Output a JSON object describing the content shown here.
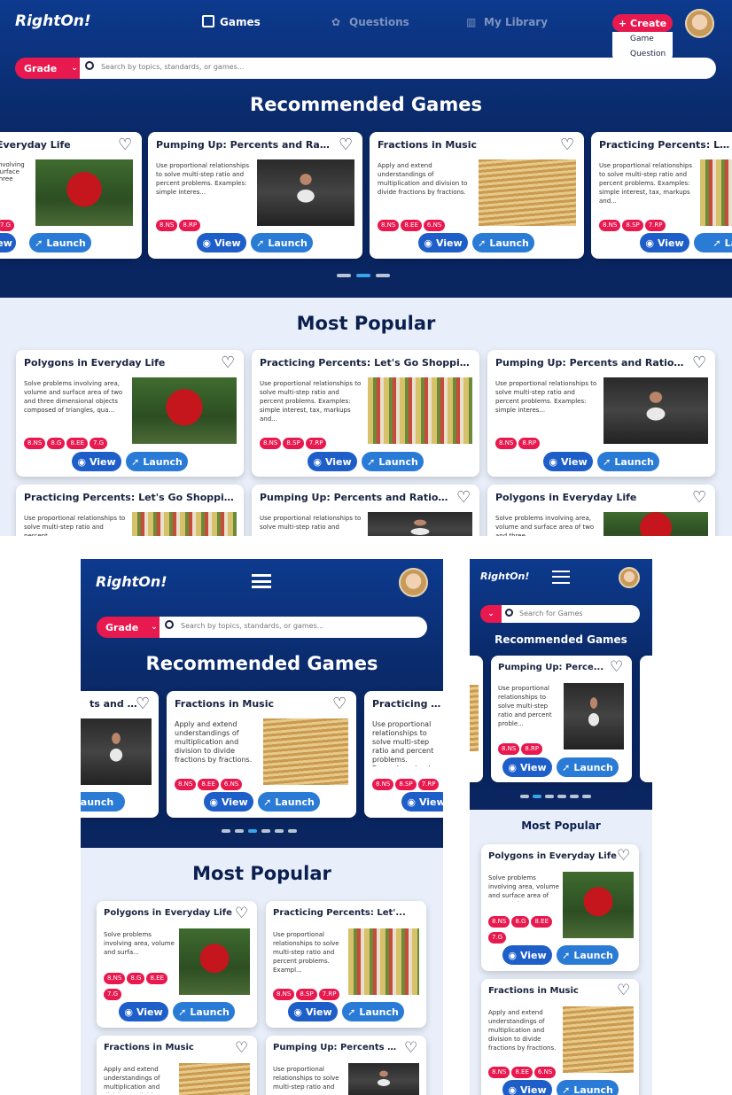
{
  "brand": "RightOn!",
  "nav": {
    "games": "Games",
    "questions": "Questions",
    "library": "My Library",
    "create": "Create",
    "create_menu": [
      "Game",
      "Question"
    ]
  },
  "search": {
    "grade": "Grade",
    "placeholder": "Search by topics, standards, or games...",
    "placeholder_mobile": "Search for Games"
  },
  "sections": {
    "recommended": "Recommended Games",
    "popular": "Most Popular"
  },
  "buttons": {
    "view": "View",
    "launch": "Launch"
  },
  "games": {
    "poly": {
      "title": "Polygons in Everyday Life",
      "desc": "Solve problems involving area, volume and surface area of two and three dimensional objects composed of triangles, qua...",
      "tags": [
        "8.NS",
        "8.G",
        "8.EE",
        "7.G"
      ]
    },
    "pump": {
      "title": "Pumping Up: Percents and Ratios at t...",
      "desc": "Use proportional relationships to solve multi-step ratio and percent problems. Examples: simple interes...",
      "tags": [
        "8.NS",
        "8.RP"
      ]
    },
    "frac": {
      "title": "Fractions in Music",
      "desc": "Apply and extend understandings of multiplication and division to divide fractions by fractions.",
      "tags": [
        "8.NS",
        "8.EE",
        "6.NS"
      ]
    },
    "shop": {
      "title": "Practicing Percents: Let's Go Shopping!",
      "desc": "Use proportional relationships to solve multi-step ratio and percent problems. Examples: simple interest, tax, markups and...",
      "tags": [
        "8.NS",
        "8.SP",
        "7.RP"
      ]
    }
  },
  "text": {
    "everyday": "Everyday Life",
    "pump_a": "Pumping Up: Percents and Ratios...",
    "pump_b": "Pumping Up: Percents and Ratios at t...",
    "pump_c": "Pumping Up: Perce...",
    "pump_d": "Pumping Up: Percents a...",
    "shop_a": "Practicing Percents: Let's G",
    "shop_b": "Practicing Percents: Let'...",
    "shop_c": "Practicing Perc",
    "ratios_tail": "ts and Ra...",
    "poly_desc_a": "Solve problems involving area, volume and surfa...",
    "poly_desc_b": "Solve problems involving area, volume and surface area of two and three",
    "pump_desc_a": "Use proportional relationships to solve multi-step ratio and percent problems. Examples: simple interes...",
    "pump_desc_b": "Use proportional relationships to solve multi-step ratio and percent",
    "pump_desc_c": "Use proportional relationships to solve multi-step ratio and percent proble...",
    "shop_desc_a": "Use proportional relationships to solve multi-step ratio and percent problems. Exampl...",
    "shop_desc_b": "Use proportional relationships to solve multi-step ratio and percent problems. Examples: simple in",
    "shop_desc_c": "Use proportional relationships to solve multi-step ratio and percent",
    "frac_desc_a": "Apply and extend understandings of multiplication and division to divide fractions by fractions.",
    "frac_desc_b": "Apply and extend understandings of multiplication and division to divide fractions by fractions.",
    "frac_desc_c": "Apply and extend understandings of multiplication and division to divide",
    "ev_desc": "involving surface three",
    "ev_desc2": "Use proportional relationships to solve multi-step ratio and"
  },
  "carousel": {
    "desktop_active": 1,
    "tablet_active": 2,
    "mobile_active": 1
  },
  "colors": {
    "navy": "#0b2a6b",
    "accent": "#e8194f",
    "blue": "#1e5ec9",
    "light": "#e9effa"
  }
}
